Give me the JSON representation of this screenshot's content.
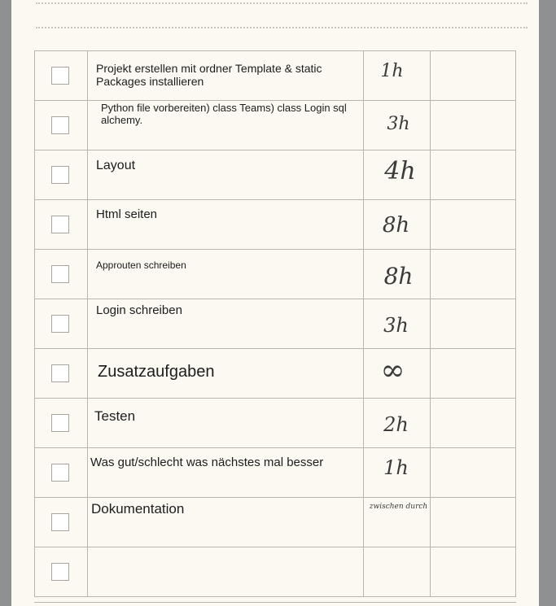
{
  "tasks": [
    {
      "text": "Projekt erstellen mit ordner Template & static Packages installieren",
      "hours": "1h"
    },
    {
      "text": "Python file vorbereiten) class Teams) class Login sql alchemy.",
      "hours": "3h"
    },
    {
      "text": "Layout",
      "hours": "4h"
    },
    {
      "text": "Html seiten",
      "hours": "8h"
    },
    {
      "text": "Approuten schreiben",
      "hours": "8h"
    },
    {
      "text": "Login schreiben",
      "hours": "3h"
    },
    {
      "text": "Zusatzaufgaben",
      "hours": "∞"
    },
    {
      "text": "Testen",
      "hours": "2h"
    },
    {
      "text": "Was gut/schlecht was nächstes mal besser",
      "hours": "1h"
    },
    {
      "text": "Dokumentation",
      "hours": "zwischen durch"
    },
    {
      "text": "",
      "hours": ""
    }
  ]
}
